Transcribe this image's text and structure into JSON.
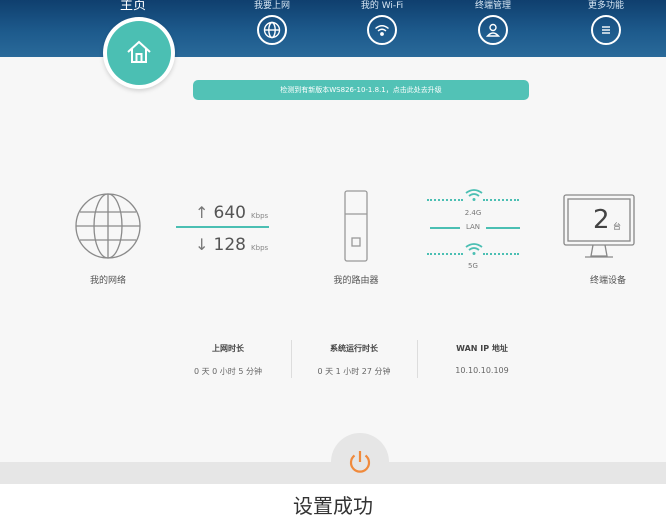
{
  "header": {
    "home_label": "主页",
    "nav": [
      {
        "label": "我要上网",
        "icon": "globe-icon"
      },
      {
        "label": "我的 Wi-Fi",
        "icon": "wifi-icon"
      },
      {
        "label": "终端管理",
        "icon": "user-icon"
      },
      {
        "label": "更多功能",
        "icon": "menu-icon"
      }
    ]
  },
  "update_banner": "检测到有新版本WS826-10-1.8.1，点击此处去升级",
  "network": {
    "my_network_label": "我的网络",
    "upload_speed": "640",
    "download_speed": "128",
    "speed_unit": "Kbps",
    "router_label": "我的路由器",
    "band_24": "2.4G",
    "band_lan": "LAN",
    "band_5": "5G",
    "devices_count": "2",
    "devices_unit": "台",
    "devices_label": "终端设备"
  },
  "stats": [
    {
      "label": "上网时长",
      "value": "0 天 0 小时 5 分钟"
    },
    {
      "label": "系统运行时长",
      "value": "0 天 1 小时 27 分钟"
    },
    {
      "label": "WAN IP 地址",
      "value": "10.10.10.109"
    }
  ],
  "toast": "设置成功",
  "colors": {
    "header": "#1d5a8c",
    "accent": "#4bbfb3",
    "power_icon": "#f08a3c"
  }
}
